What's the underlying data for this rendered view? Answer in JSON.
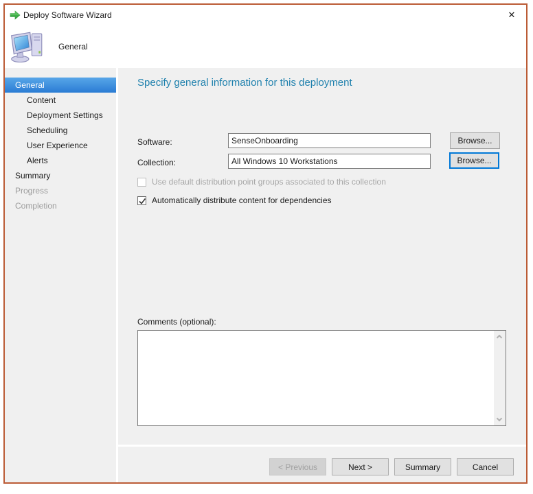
{
  "window": {
    "title": "Deploy Software Wizard",
    "close_glyph": "✕"
  },
  "header": {
    "page_label": "General"
  },
  "sidebar": {
    "items": [
      {
        "label": "General",
        "state": "selected",
        "indent": 0
      },
      {
        "label": "Content",
        "state": "normal",
        "indent": 1
      },
      {
        "label": "Deployment Settings",
        "state": "normal",
        "indent": 1
      },
      {
        "label": "Scheduling",
        "state": "normal",
        "indent": 1
      },
      {
        "label": "User Experience",
        "state": "normal",
        "indent": 1
      },
      {
        "label": "Alerts",
        "state": "normal",
        "indent": 1
      },
      {
        "label": "Summary",
        "state": "normal",
        "indent": 0
      },
      {
        "label": "Progress",
        "state": "disabled",
        "indent": 0
      },
      {
        "label": "Completion",
        "state": "disabled",
        "indent": 0
      }
    ]
  },
  "content": {
    "heading": "Specify general information for this deployment",
    "software": {
      "label": "Software:",
      "value": "SenseOnboarding",
      "browse_label": "Browse..."
    },
    "collection": {
      "label": "Collection:",
      "value": "All Windows 10 Workstations",
      "browse_label": "Browse..."
    },
    "checkbox_default_dp": {
      "label": "Use default distribution point groups associated to this collection",
      "checked": false,
      "enabled": false
    },
    "checkbox_auto_distribute": {
      "label": "Automatically distribute content for dependencies",
      "checked": true,
      "enabled": true
    },
    "comments": {
      "label": "Comments (optional):",
      "value": ""
    }
  },
  "footer": {
    "previous_label": "< Previous",
    "next_label": "Next >",
    "summary_label": "Summary",
    "cancel_label": "Cancel"
  },
  "colors": {
    "window_border": "#bb5b35",
    "heading_text": "#1e80ad",
    "selected_item_top": "#58a6e8",
    "selected_item_bottom": "#2a7cd4",
    "focus_border": "#0078d7",
    "arrow_green": "#3fae49"
  }
}
